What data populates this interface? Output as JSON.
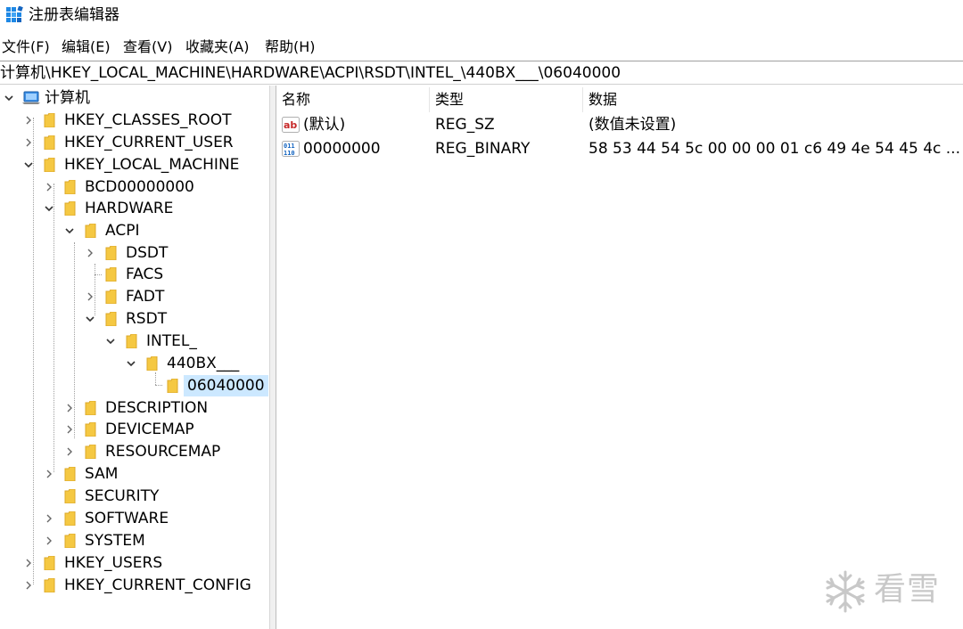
{
  "window": {
    "title": "注册表编辑器",
    "icon": "regedit-icon"
  },
  "menu": [
    "文件(F)",
    "编辑(E)",
    "查看(V)",
    "收藏夹(A)",
    "帮助(H)"
  ],
  "address": "计算机\\HKEY_LOCAL_MACHINE\\HARDWARE\\ACPI\\RSDT\\INTEL_\\440BX___\\06040000",
  "tree": {
    "root": "计算机",
    "items": [
      "HKEY_CLASSES_ROOT",
      "HKEY_CURRENT_USER",
      "HKEY_LOCAL_MACHINE",
      "BCD00000000",
      "HARDWARE",
      "ACPI",
      "DSDT",
      "FACS",
      "FADT",
      "RSDT",
      "INTEL_",
      "440BX___",
      "06040000",
      "DESCRIPTION",
      "DEVICEMAP",
      "RESOURCEMAP",
      "SAM",
      "SECURITY",
      "SOFTWARE",
      "SYSTEM",
      "HKEY_USERS",
      "HKEY_CURRENT_CONFIG"
    ],
    "selected": "06040000"
  },
  "list": {
    "columns": [
      "名称",
      "类型",
      "数据"
    ],
    "rows": [
      {
        "name": "(默认)",
        "type": "REG_SZ",
        "data": "(数值未设置)",
        "icon": "string-value-icon"
      },
      {
        "name": "00000000",
        "type": "REG_BINARY",
        "data": "58 53 44 54 5c 00 00 00 01 c6 49 4e 54 45 4c ...",
        "icon": "binary-value-icon"
      }
    ]
  },
  "watermark": {
    "text": "看雪",
    "icon": "snowflake-icon"
  },
  "colors": {
    "selection": "#cce8ff",
    "folder": "#f5c842",
    "folder_dark": "#dca82a"
  }
}
